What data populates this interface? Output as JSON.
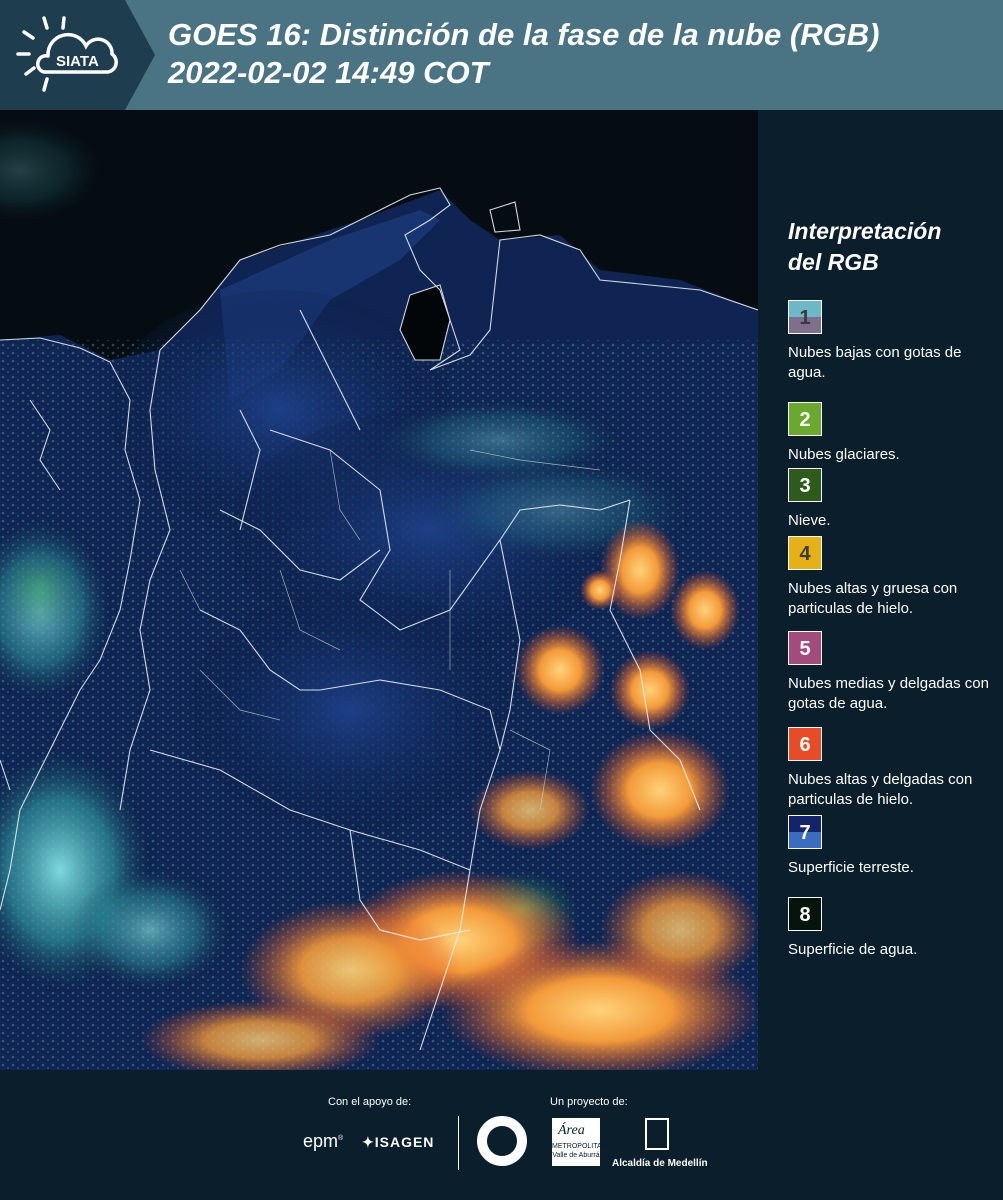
{
  "header": {
    "logo_text": "SIATA",
    "title": "GOES 16: Distinción de la fase de la nube (RGB)\n 2022-02-02 14:49 COT"
  },
  "legend": {
    "title": "Interpretación\ndel RGB",
    "items": [
      {
        "num": "1",
        "label": "Nubes bajas con gotas de agua.",
        "color_top": "#6cb8c9",
        "color_bottom": "#7e6f8d",
        "text_color": "#3a3a3a"
      },
      {
        "num": "2",
        "label": "Nubes glaciares.",
        "color_top": "#6aa82e",
        "color_bottom": "#6aa82e",
        "text_color": "#ffffff"
      },
      {
        "num": "3",
        "label": "Nieve.",
        "color_top": "#2e5a1c",
        "color_bottom": "#2e5a1c",
        "text_color": "#ffffff"
      },
      {
        "num": "4",
        "label": "Nubes altas y gruesa con particulas de hielo.",
        "color_top": "#e6b117",
        "color_bottom": "#e6b117",
        "text_color": "#3a3a3a"
      },
      {
        "num": "5",
        "label": "Nubes medias y delgadas con gotas de agua.",
        "color_top": "#a34b7d",
        "color_bottom": "#a34b7d",
        "text_color": "#ffffff"
      },
      {
        "num": "6",
        "label": "Nubes altas y delgadas con particulas de hielo.",
        "color_top": "#e84c26",
        "color_bottom": "#e84c26",
        "text_color": "#ffffff"
      },
      {
        "num": "7",
        "label": "Superficie terreste.",
        "color_top": "#15246a",
        "color_bottom": "#3a6cc0",
        "text_color": "#ffffff"
      },
      {
        "num": "8",
        "label": "Superficie de agua.",
        "color_top": "#05150c",
        "color_bottom": "#05150c",
        "text_color": "#ffffff"
      }
    ]
  },
  "footer": {
    "support_label": "Con el apoyo de:",
    "project_label": "Un proyecto de:",
    "epm": "epm",
    "epm_reg": "®",
    "isagen": "ISAGEN",
    "area_text": "METROPOLITANA Valle de Aburrá",
    "area_script": "Área",
    "alcaldia": "Alcaldía de Medellín"
  }
}
